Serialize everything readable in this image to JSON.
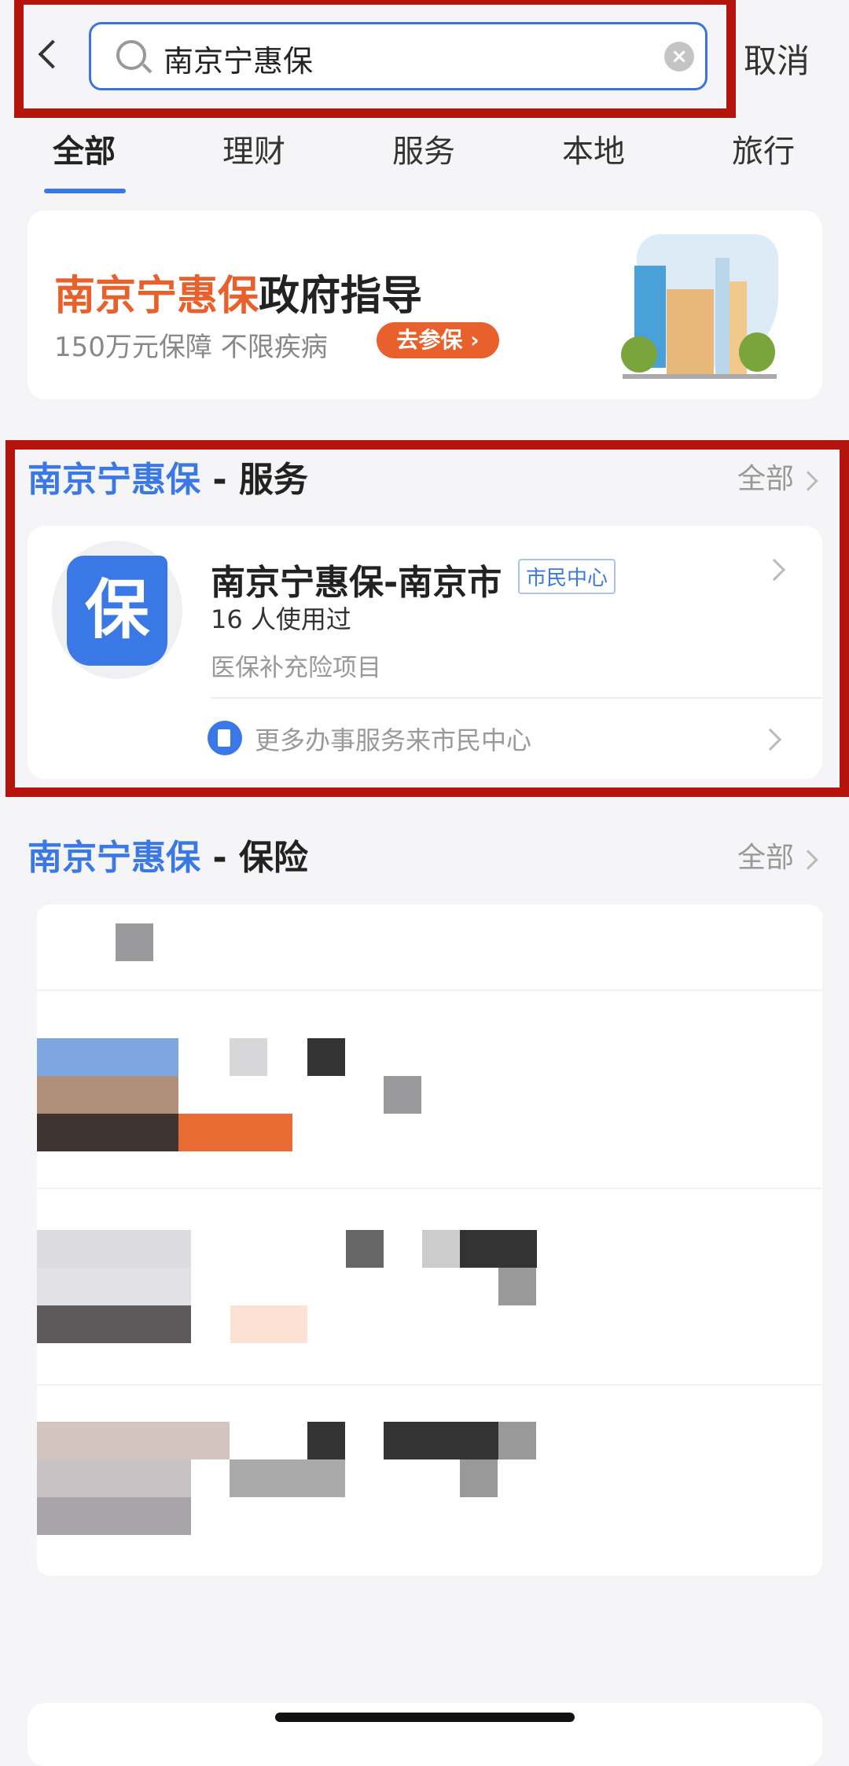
{
  "search": {
    "query": "南京宁惠保",
    "cancel_label": "取消"
  },
  "tabs": [
    {
      "label": "全部",
      "active": true
    },
    {
      "label": "理财"
    },
    {
      "label": "服务"
    },
    {
      "label": "本地"
    },
    {
      "label": "旅行"
    }
  ],
  "banner": {
    "title_highlight": "南京宁惠保",
    "title_rest": "政府指导",
    "subtitle": "150万元保障 不限疾病",
    "cta": "去参保"
  },
  "service_section": {
    "title_highlight": "南京宁惠保",
    "title_rest": " - 服务",
    "more_label": "全部",
    "item": {
      "icon_char": "保",
      "title": "南京宁惠保-南京市",
      "tag": "市民中心",
      "usage": "16 人使用过",
      "desc": "医保补充险项目"
    },
    "footer_link": "更多办事服务来市民中心"
  },
  "insurance_section": {
    "title_highlight": "南京宁惠保",
    "title_rest": " - 保险",
    "more_label": "全部"
  },
  "colors": {
    "accent": "#3a78e6",
    "orange": "#e8602c",
    "annotation_red": "#b5140c"
  }
}
